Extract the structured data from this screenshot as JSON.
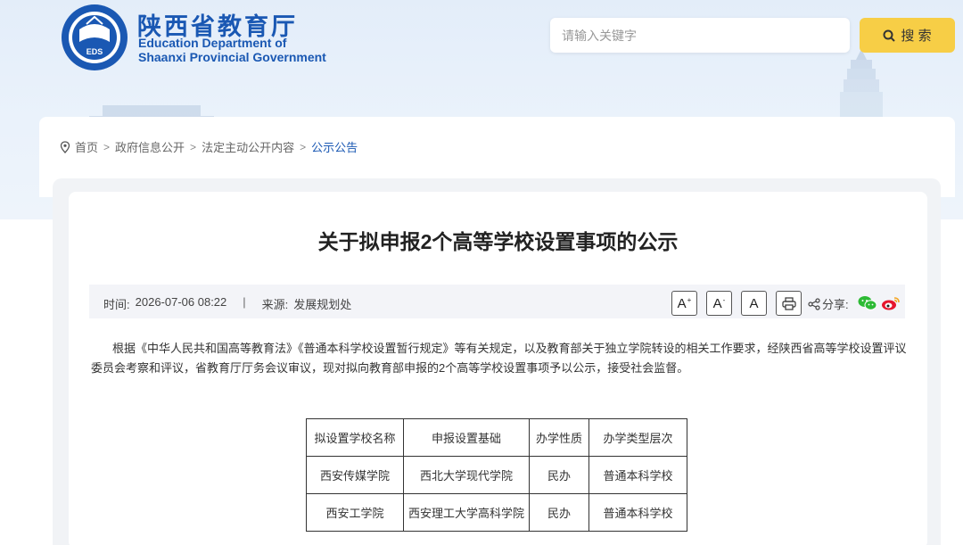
{
  "header": {
    "site_name_cn": "陕西省教育厅",
    "site_name_en_line1": "Education Department of",
    "site_name_en_line2": "Shaanxi Provincial Government",
    "logo_text": "EDS",
    "logo_ring_text": "EDUCATION DEPARTMENT OF SHAANXI · 陕西省教育厅",
    "search": {
      "placeholder": "请输入关键字",
      "button_label": "搜 索",
      "button_color": "#f7ce46"
    },
    "brand_color": "#1a58b3"
  },
  "breadcrumb": {
    "items": [
      "首页",
      "政府信息公开",
      "法定主动公开内容",
      "公示公告"
    ],
    "separator": ">"
  },
  "article": {
    "title": "关于拟申报2个高等学校设置事项的公示",
    "meta": {
      "time_label": "时间:",
      "time_value": "2026-07-06 08:22",
      "divider": "|",
      "source_label": "来源:",
      "source_value": "发展规划处"
    },
    "tools": {
      "font_larger": "A",
      "font_larger_sup": "+",
      "font_smaller": "A",
      "font_smaller_sup": "-",
      "font_reset": "A",
      "share_label": "分享:"
    },
    "paragraph": "根据《中华人民共和国高等教育法》《普通本科学校设置暂行规定》等有关规定，以及教育部关于独立学院转设的相关工作要求，经陕西省高等学校设置评议委员会考察和评议，省教育厅厅务会议审议，现对拟向教育部申报的2个高等学校设置事项予以公示，接受社会监督。",
    "table": {
      "headers": [
        "拟设置学校名称",
        "申报设置基础",
        "办学性质",
        "办学类型层次"
      ],
      "rows": [
        [
          "西安传媒学院",
          "西北大学现代学院",
          "民办",
          "普通本科学校"
        ],
        [
          "西安工学院",
          "西安理工大学高科学院",
          "民办",
          "普通本科学校"
        ]
      ]
    }
  },
  "icons": [
    "location-icon",
    "search-icon",
    "print-icon",
    "share-icon",
    "wechat-icon",
    "weibo-icon"
  ]
}
